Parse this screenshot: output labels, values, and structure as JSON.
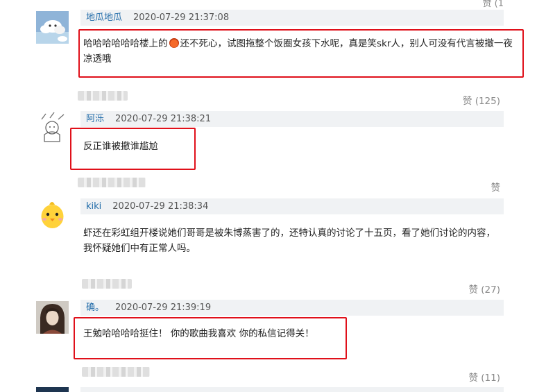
{
  "top_likes_partial": "赞 (1",
  "comments": [
    {
      "username": "地瓜地瓜",
      "time": "2020-07-29 21:37:08",
      "text_before_emoji": "哈哈哈哈哈哈楼上的",
      "emoji_icon": "angry-face-emoji",
      "text_after_emoji": "还不死心，试图拖整个饭圈女孩下水呢，真是笑skr人，别人可没有代言被撤一夜凉透哦",
      "likes": "赞 (125)"
    },
    {
      "username": "阿泺",
      "time": "2020-07-29 21:38:21",
      "text": "反正谁被撤谁尴尬",
      "likes": "赞"
    },
    {
      "username": "kiki",
      "time": "2020-07-29 21:38:34",
      "text": "虾还在彩虹组开楼说她们哥哥是被朱博蒸害了的，还特认真的讨论了十五页，看了她们讨论的内容，我怀疑她们中有正常人吗。",
      "likes": "赞 (27)"
    },
    {
      "username": "确。",
      "time": "2020-07-29 21:39:19",
      "text": "王勉哈哈哈哈挺住！ 你的歌曲我喜欢 你的私信记得关！",
      "likes": "赞 (11)"
    }
  ],
  "highlight_color": "#e0101a",
  "username_color": "#1f6aa8"
}
